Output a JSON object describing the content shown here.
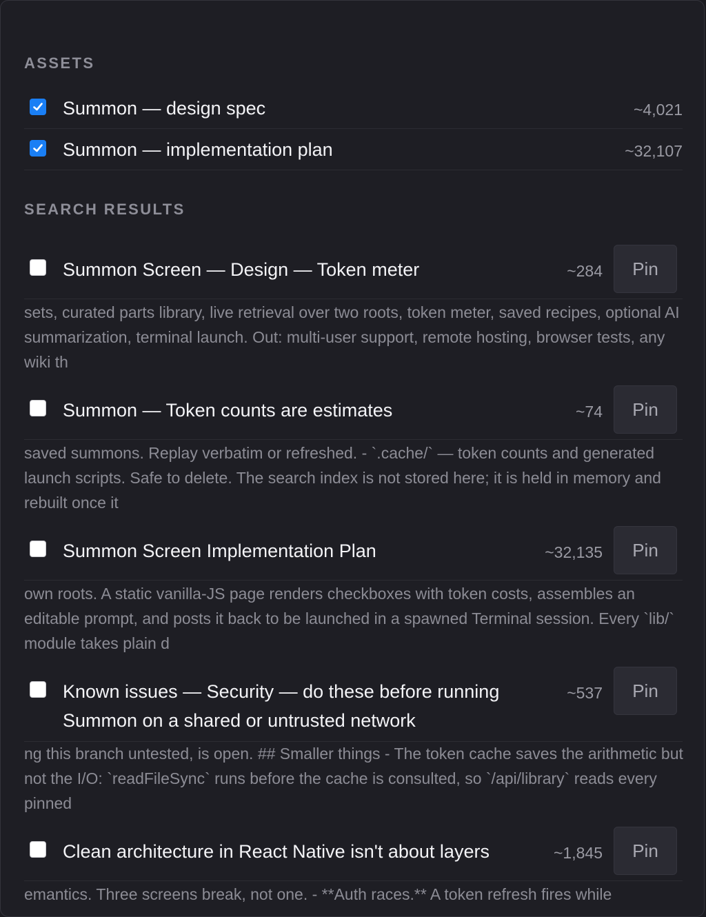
{
  "assets": {
    "heading": "ASSETS",
    "items": [
      {
        "title": "Summon — design spec",
        "tokens": "~4,021",
        "checked": true
      },
      {
        "title": "Summon — implementation plan",
        "tokens": "~32,107",
        "checked": true
      }
    ]
  },
  "search": {
    "heading": "SEARCH RESULTS",
    "pin_label": "Pin",
    "results": [
      {
        "title": "Summon Screen — Design — Token meter",
        "tokens": "~284",
        "snippet": "sets, curated parts library, live retrieval over two roots, token meter, saved recipes, optional AI summarization, terminal launch. Out: multi-user support, remote hosting, browser tests, any wiki th"
      },
      {
        "title": "Summon — Token counts are estimates",
        "tokens": "~74",
        "snippet": "saved summons. Replay verbatim or refreshed. - `.cache/` — token counts and generated launch scripts. Safe to delete. The search index is not stored here; it is held in memory and rebuilt once it"
      },
      {
        "title": "Summon Screen Implementation Plan",
        "tokens": "~32,135",
        "snippet": "own roots. A static vanilla-JS page renders checkboxes with token costs, assembles an editable prompt, and posts it back to be launched in a spawned Terminal session. Every `lib/` module takes plain d"
      },
      {
        "title_line1": "Known issues — Security — do these before running",
        "title_line2": "Summon on a shared or untrusted network",
        "tokens": "~537",
        "snippet": "ng this branch untested, is open. ## Smaller things - The token cache saves the arithmetic but not the I/O: `readFileSync` runs before the cache is consulted, so `/api/library` reads every pinned"
      },
      {
        "title": "Clean architecture in React Native isn't about layers",
        "tokens": "~1,845",
        "snippet": "emantics. Three screens break, not one. - **Auth races.** A token refresh fires while"
      }
    ]
  }
}
